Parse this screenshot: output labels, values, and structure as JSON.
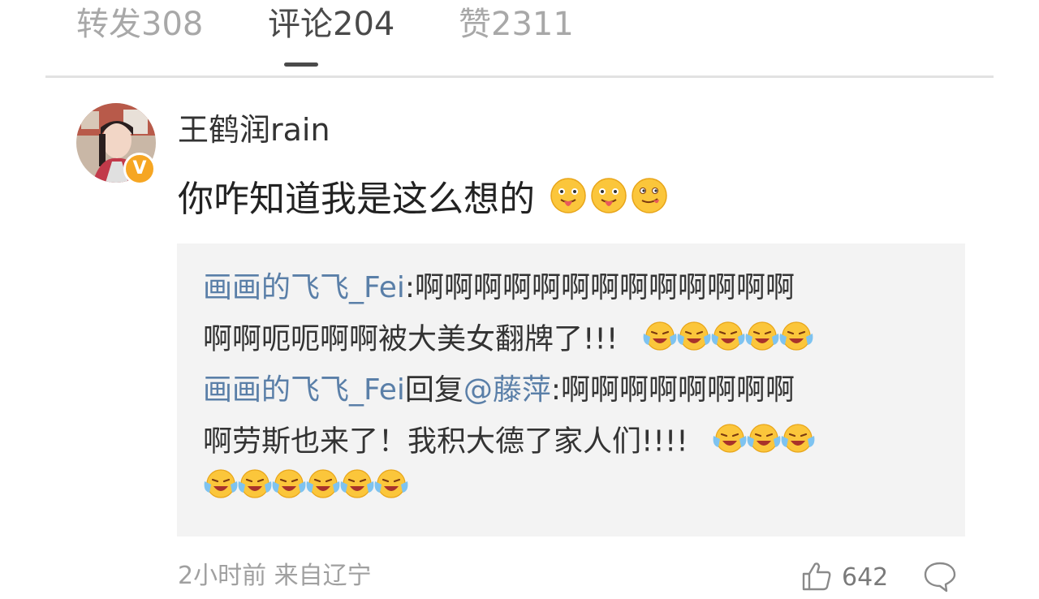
{
  "tabs": {
    "repost": "转发308",
    "comments": "评论204",
    "likes": "赞2311",
    "active": "comments"
  },
  "comment": {
    "username": "王鹤润rain",
    "text": "你咋知道我是这么想的",
    "text_emojis": [
      "tongue-out-emoji",
      "tongue-out-emoji",
      "yum-emoji"
    ],
    "verified_badge": "V",
    "replies": [
      {
        "line1_author": "画画的飞飞_Fei",
        "line1_text": ":啊啊啊啊啊啊啊啊啊啊啊啊啊",
        "line2_text": "啊啊呃呃啊啊被大美女翻牌了!!! ",
        "emojis": [
          "laugh-cry-emoji",
          "laugh-cry-emoji",
          "laugh-cry-emoji",
          "laugh-cry-emoji",
          "laugh-cry-emoji"
        ]
      },
      {
        "line1_author": "画画的飞飞_Fei",
        "line1_mid": "回复",
        "line1_mention": "@藤萍",
        "line1_text": ":啊啊啊啊啊啊啊啊",
        "line2_text": "啊劳斯也来了！我积大德了家人们!!!! ",
        "emojis_line2": [
          "laugh-cry-emoji",
          "laugh-cry-emoji",
          "laugh-cry-emoji"
        ],
        "emojis_line3": [
          "laugh-cry-emoji",
          "laugh-cry-emoji",
          "laugh-cry-emoji",
          "laugh-cry-emoji",
          "laugh-cry-emoji",
          "laugh-cry-emoji"
        ]
      }
    ],
    "meta": "2小时前 来自辽宁",
    "like_count": "642",
    "like_icon": "thumbs-up-icon",
    "comment_icon": "comment-bubble-icon"
  },
  "colors": {
    "link": "#5a7fa8",
    "tab_active": "#4a4a4a",
    "tab_inactive": "#a8a8a8",
    "reply_bg": "#f3f3f3",
    "badge": "#f6a623"
  }
}
